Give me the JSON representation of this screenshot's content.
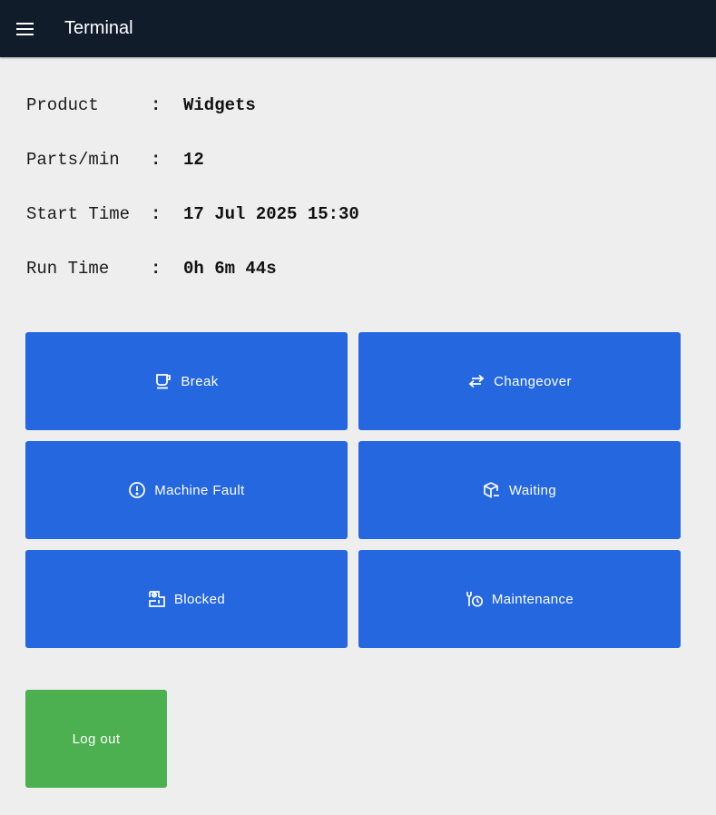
{
  "header": {
    "title": "Terminal",
    "menu_icon": "hamburger-menu-icon"
  },
  "info": {
    "rows": [
      {
        "label": "Product",
        "sep": ":",
        "value": "Widgets"
      },
      {
        "label": "Parts/min",
        "sep": ":",
        "value": "12"
      },
      {
        "label": "Start Time",
        "sep": ":",
        "value": "17 Jul 2025 15:30"
      },
      {
        "label": "Run Time",
        "sep": ":",
        "value": "0h 6m 44s"
      }
    ]
  },
  "actions": {
    "break": {
      "label": "Break",
      "icon": "coffee-cup-icon"
    },
    "changeover": {
      "label": "Changeover",
      "icon": "swap-arrows-icon"
    },
    "machine_fault": {
      "label": "Machine Fault",
      "icon": "alert-circle-icon"
    },
    "waiting": {
      "label": "Waiting",
      "icon": "package-wait-icon"
    },
    "blocked": {
      "label": "Blocked",
      "icon": "blocked-icon"
    },
    "maintenance": {
      "label": "Maintenance",
      "icon": "wrench-clock-icon"
    }
  },
  "logout": {
    "label": "Log out"
  },
  "colors": {
    "appbar": "#111c2b",
    "background": "#eeeeee",
    "action_tile": "#2467de",
    "logout": "#4cb050"
  }
}
